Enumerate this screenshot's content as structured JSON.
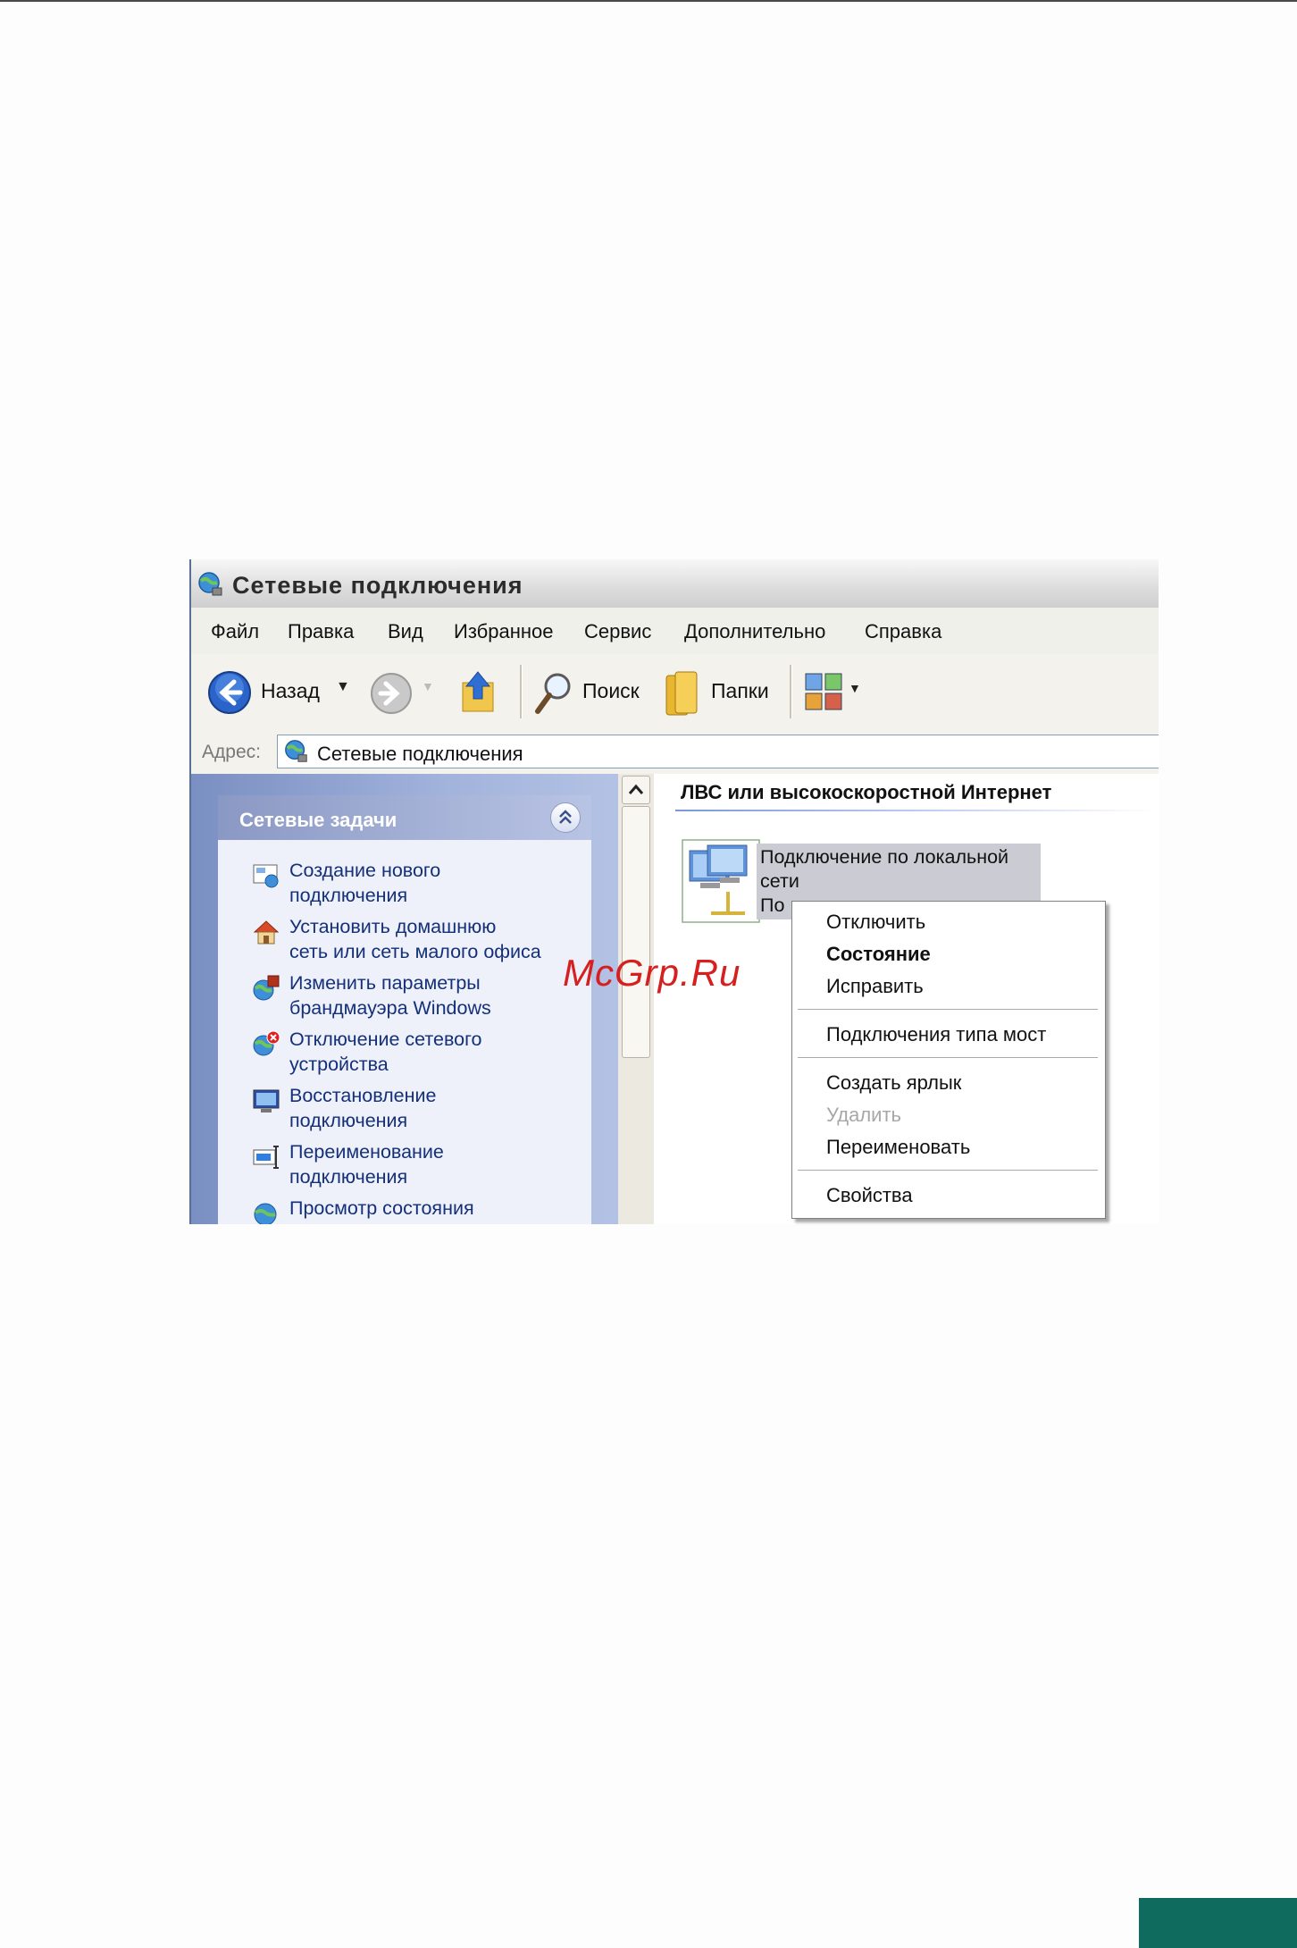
{
  "window": {
    "title": "Сетевые подключения"
  },
  "menu": [
    "Файл",
    "Правка",
    "Вид",
    "Избранное",
    "Сервис",
    "Дополнительно",
    "Справка"
  ],
  "toolbar": {
    "back_label": "Назад",
    "search_label": "Поиск",
    "folders_label": "Папки"
  },
  "address": {
    "label": "Адрес:",
    "value": "Сетевые подключения"
  },
  "tasks_panel": {
    "title": "Сетевые задачи",
    "items": [
      {
        "line1": "Создание нового",
        "line2": "подключения",
        "icon": "new-connection-icon"
      },
      {
        "line1": "Установить домашнюю",
        "line2": "сеть или сеть малого офиса",
        "icon": "home-network-icon"
      },
      {
        "line1": "Изменить параметры",
        "line2": "брандмауэра Windows",
        "icon": "firewall-icon"
      },
      {
        "line1": "Отключение сетевого",
        "line2": "устройства",
        "icon": "disable-device-icon"
      },
      {
        "line1": "Восстановление",
        "line2": "подключения",
        "icon": "repair-connection-icon"
      },
      {
        "line1": "Переименование",
        "line2": "подключения",
        "icon": "rename-connection-icon"
      },
      {
        "line1": "Просмотр состояния",
        "line2": "",
        "icon": "view-status-icon"
      }
    ]
  },
  "content": {
    "group_title": "ЛВС или высокоскоростной Интернет",
    "connection": {
      "line1": "Подключение по локальной",
      "line2": "сети",
      "line3": "По"
    }
  },
  "context_menu": {
    "items": [
      {
        "label": "Отключить",
        "state": "normal"
      },
      {
        "label": "Состояние",
        "state": "default"
      },
      {
        "label": "Исправить",
        "state": "normal"
      },
      {
        "label": "Подключения типа мост",
        "state": "normal"
      },
      {
        "label": "Создать ярлык",
        "state": "normal"
      },
      {
        "label": "Удалить",
        "state": "disabled"
      },
      {
        "label": "Переименовать",
        "state": "normal"
      },
      {
        "label": "Свойства",
        "state": "normal"
      }
    ]
  },
  "watermark": "McGrp.Ru",
  "colors": {
    "accent": "#0e6b5d",
    "watermark": "#d61f1f",
    "link": "#15307a"
  }
}
